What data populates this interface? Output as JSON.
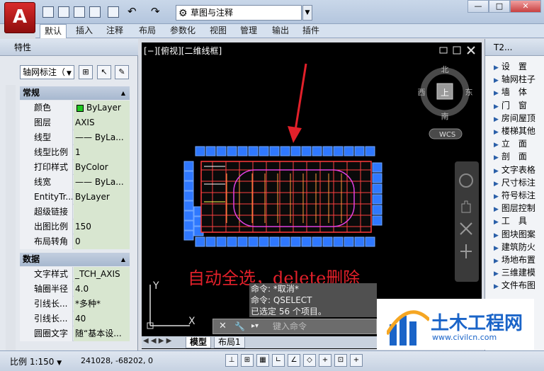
{
  "titlebar": {
    "app_letter": "A",
    "workspace": "草图与注释",
    "min": "—",
    "max": "□",
    "close": "✕"
  },
  "ribbon_tabs": [
    "默认",
    "插入",
    "注释",
    "布局",
    "参数化",
    "视图",
    "管理",
    "输出",
    "插件"
  ],
  "properties": {
    "title": "特性",
    "object_type": "轴网标注（",
    "section_general": "常规",
    "general": [
      {
        "k": "颜色",
        "v": "ByLayer"
      },
      {
        "k": "图层",
        "v": "AXIS"
      },
      {
        "k": "线型",
        "v": "—— ByLa..."
      },
      {
        "k": "线型比例",
        "v": "1"
      },
      {
        "k": "打印样式",
        "v": "ByColor"
      },
      {
        "k": "线宽",
        "v": "—— ByLa..."
      },
      {
        "k": "EntityTr...",
        "v": "ByLayer"
      },
      {
        "k": "超级链接",
        "v": ""
      },
      {
        "k": "出图比例",
        "v": "150"
      },
      {
        "k": "布局转角",
        "v": "0"
      }
    ],
    "section_data": "数据",
    "data": [
      {
        "k": "文字样式",
        "v": "_TCH_AXIS"
      },
      {
        "k": "轴圈半径",
        "v": "4.0"
      },
      {
        "k": "引线长...",
        "v": "*多种*"
      },
      {
        "k": "引线长...",
        "v": "40"
      },
      {
        "k": "圆圈文字",
        "v": "随“基本设..."
      }
    ]
  },
  "viewport": {
    "label": "[−][俯视][二维线框]",
    "compass": {
      "n": "北",
      "s": "南",
      "e": "东",
      "w": "西",
      "top": "上"
    },
    "wcs": "WCS",
    "annotation": "自动全选，delete删除",
    "axis_y": "Y",
    "axis_x": "X"
  },
  "command": {
    "history": [
      "命令: *取消*",
      "命令: QSELECT",
      "已选定 56 个项目。"
    ],
    "placeholder": "键入命令"
  },
  "layout_tabs": [
    "模型",
    "布局1"
  ],
  "right_panel": {
    "title": "T2...",
    "items": [
      "设　置",
      "轴网柱子",
      "墙　体",
      "门　窗",
      "房间屋顶",
      "楼梯其他",
      "立　面",
      "剖　面",
      "文字表格",
      "尺寸标注",
      "符号标注",
      "图层控制",
      "工　具",
      "图块图案",
      "建筑防火",
      "场地布置",
      "三维建模",
      "文件布图"
    ]
  },
  "statusbar": {
    "scale": "比例 1:150",
    "coords": "241028, -68202, 0"
  },
  "watermark": {
    "name": "土木工程网",
    "url": "www.civilcn.com"
  }
}
